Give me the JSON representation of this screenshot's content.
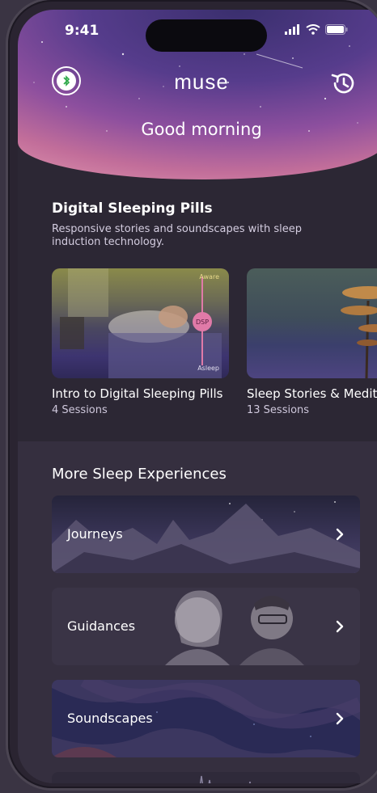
{
  "status": {
    "time": "9:41"
  },
  "header": {
    "logo": "muse",
    "greeting": "Good morning"
  },
  "section1": {
    "title": "Digital Sleeping Pills",
    "subtitle": "Responsive stories and soundscapes with sleep induction technology.",
    "cards": [
      {
        "title": "Intro to Digital Sleeping Pills",
        "meta": "4 Sessions",
        "aware": "Aware",
        "dsp": "DSP",
        "asleep": "Asleep"
      },
      {
        "title": "Sleep Stories & Medita",
        "meta": "13 Sessions"
      }
    ]
  },
  "section2": {
    "title": "More Sleep Experiences",
    "items": [
      {
        "label": "Journeys"
      },
      {
        "label": "Guidances"
      },
      {
        "label": "Soundscapes"
      }
    ]
  },
  "colors": {
    "accent_pink": "#e07aa8",
    "bluetooth_green": "#2ea84a",
    "background": "#2c2734"
  }
}
